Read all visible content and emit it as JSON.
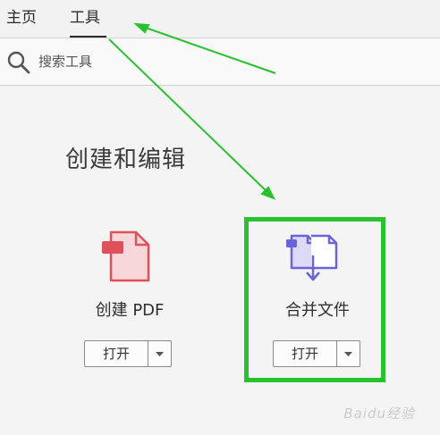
{
  "tabs": {
    "home": "主页",
    "tools": "工具"
  },
  "search": {
    "placeholder": "搜索工具"
  },
  "section": {
    "title": "创建和编辑"
  },
  "tools": [
    {
      "label": "创建 PDF",
      "button": "打开",
      "icon": "create-pdf-icon",
      "color": "#e0505a"
    },
    {
      "label": "合并文件",
      "button": "打开",
      "icon": "combine-files-icon",
      "color": "#6a63d9"
    }
  ],
  "annotation": {
    "color": "#29c22f"
  },
  "watermark": "Baidu经验"
}
